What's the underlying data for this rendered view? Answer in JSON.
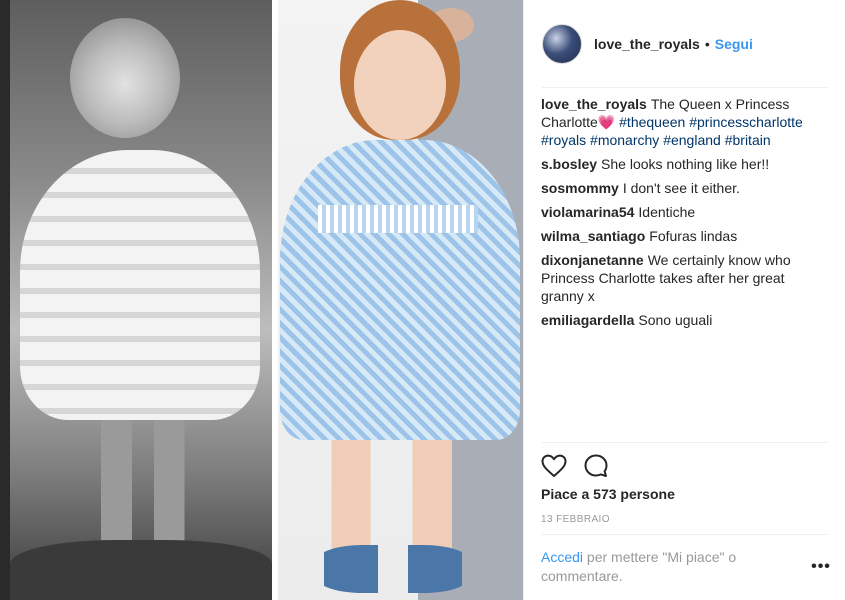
{
  "post": {
    "username": "love_the_royals",
    "dot": "•",
    "follow_label": "Segui"
  },
  "caption": {
    "username": "love_the_royals",
    "text": "The Queen x Princess Charlotte",
    "heart": "💗",
    "hashtags": [
      "#thequeen",
      "#princesscharlotte",
      "#royals",
      "#monarchy",
      "#england",
      "#britain"
    ]
  },
  "comments": [
    {
      "user": "s.bosley",
      "text": "She looks nothing like her!!"
    },
    {
      "user": "sosmommy",
      "text": "I don't see it either."
    },
    {
      "user": "violamarina54",
      "text": "Identiche"
    },
    {
      "user": "wilma_santiago",
      "text": "Fofuras lindas"
    },
    {
      "user": "dixonjanetanne",
      "text": "We certainly know who Princess Charlotte takes after her great granny x"
    },
    {
      "user": "emiliagardella",
      "text": "Sono uguali"
    }
  ],
  "actions": {
    "like_icon": "heart-outline-icon",
    "comment_icon": "speech-bubble-icon"
  },
  "likes_text": "Piace a 573 persone",
  "date": "13 FEBBRAIO",
  "footer": {
    "login_label": "Accedi",
    "rest": "per mettere \"Mi piace\" o commentare."
  },
  "more_label": "•••",
  "colors": {
    "link": "#3897f0",
    "text": "#262626",
    "muted": "#999999",
    "hashtag": "#003569"
  }
}
